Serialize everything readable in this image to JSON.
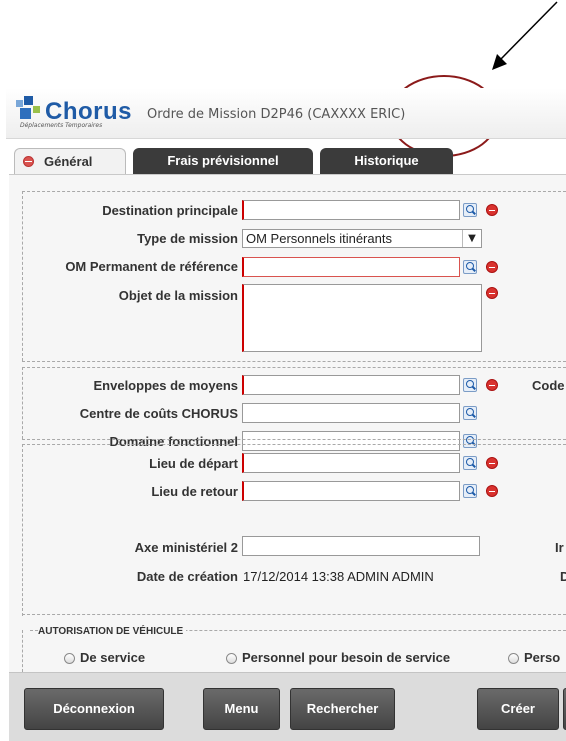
{
  "app": {
    "logo": "Chorus",
    "logo_subtitle": "Déplacements Temporaires",
    "window_title": "Ordre de Mission D2P46 (CAXXXX ERIC)"
  },
  "tabs": [
    {
      "label": "Général",
      "active": true
    },
    {
      "label": "Frais prévisionnel",
      "active": false
    },
    {
      "label": "Historique",
      "active": false
    }
  ],
  "form": {
    "destination_principale": {
      "label": "Destination principale",
      "value": ""
    },
    "type_mission": {
      "label": "Type de mission",
      "value": "OM Personnels itinérants"
    },
    "om_permanent": {
      "label": "OM Permanent de référence",
      "value": ""
    },
    "objet": {
      "label": "Objet de la mission",
      "value": ""
    },
    "enveloppes": {
      "label": "Enveloppes de moyens",
      "value": ""
    },
    "code_label": "Code",
    "centre_couts": {
      "label": "Centre de coûts CHORUS",
      "value": ""
    },
    "domaine": {
      "label": "Domaine fonctionnel",
      "value": ""
    },
    "lieu_depart": {
      "label": "Lieu de départ",
      "value": ""
    },
    "lieu_retour": {
      "label": "Lieu de retour",
      "value": ""
    },
    "axe": {
      "label": "Axe ministériel 2",
      "value": ""
    },
    "axe_right_label": "Ir",
    "date_creation": {
      "label": "Date de création",
      "value": "17/12/2014 13:38 ADMIN ADMIN"
    },
    "date_right_label": "D"
  },
  "vehicle": {
    "legend": "AUTORISATION DE VÉHICULE",
    "options": [
      "De service",
      "Personnel pour besoin de service",
      "Perso"
    ]
  },
  "footer": {
    "buttons": [
      "Déconnexion",
      "Menu",
      "Rechercher",
      "Créer"
    ]
  },
  "colors": {
    "brand": "#1f5ba6",
    "tab_dark": "#3b3b3b",
    "required": "#cc0000",
    "annotation": "#8b1a1a"
  }
}
